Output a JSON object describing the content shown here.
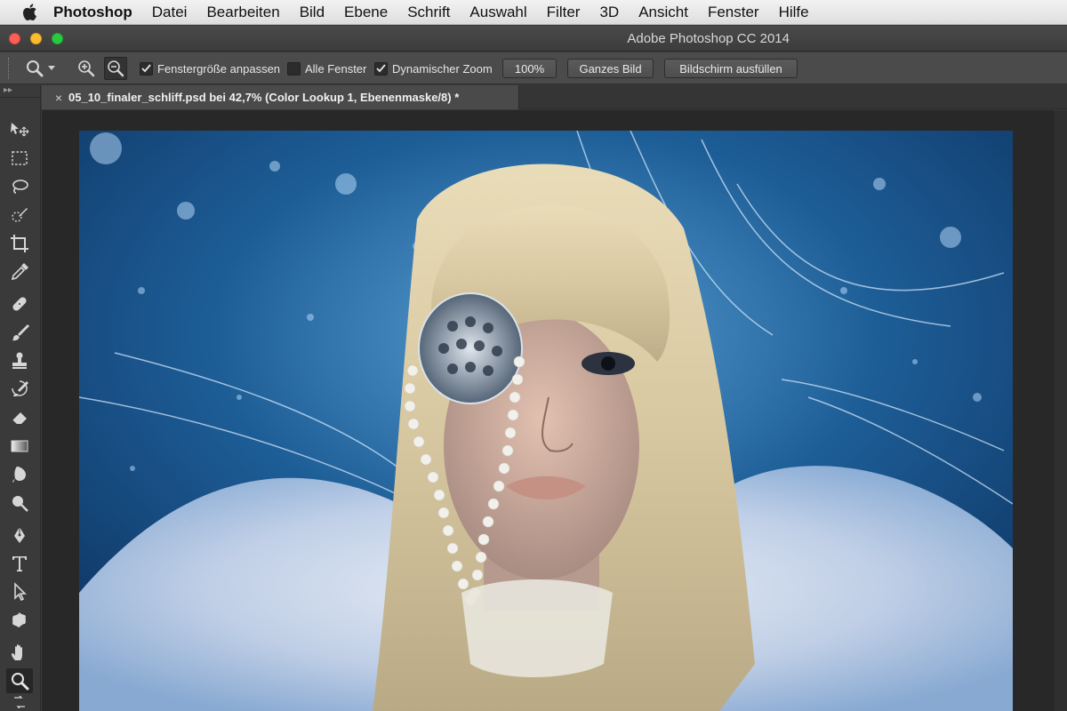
{
  "menubar": {
    "app": "Photoshop",
    "items": [
      "Datei",
      "Bearbeiten",
      "Bild",
      "Ebene",
      "Schrift",
      "Auswahl",
      "Filter",
      "3D",
      "Ansicht",
      "Fenster",
      "Hilfe"
    ]
  },
  "window": {
    "title": "Adobe Photoshop CC 2014"
  },
  "options": {
    "resize_windows_label": "Fenstergröße anpassen",
    "resize_windows_checked": true,
    "all_windows_label": "Alle Fenster",
    "all_windows_checked": false,
    "scrubby_zoom_label": "Dynamischer Zoom",
    "scrubby_zoom_checked": true,
    "zoom_100_label": "100%",
    "fit_screen_label": "Ganzes Bild",
    "fill_screen_label": "Bildschirm ausfüllen"
  },
  "document": {
    "tab_title": "05_10_finaler_schliff.psd bei 42,7% (Color Lookup 1, Ebenenmaske/8) *",
    "tab_close": "×"
  },
  "toolbar": {
    "header": "▸▸",
    "tools": [
      "move-tool",
      "marquee-tool",
      "lasso-tool",
      "quick-selection-tool",
      "crop-tool",
      "eyedropper-tool",
      "healing-brush-tool",
      "brush-tool",
      "clone-stamp-tool",
      "history-brush-tool",
      "eraser-tool",
      "gradient-tool",
      "blur-tool",
      "dodge-tool",
      "pen-tool",
      "type-tool",
      "path-selection-tool",
      "shape-tool",
      "hand-tool",
      "zoom-tool"
    ],
    "active_tool": "zoom-tool"
  },
  "colors": {
    "traffic_close": "#fc5f57",
    "traffic_minimize": "#fdbb2e",
    "traffic_maximize": "#29c940",
    "panel_bg": "#3b3b3b"
  }
}
